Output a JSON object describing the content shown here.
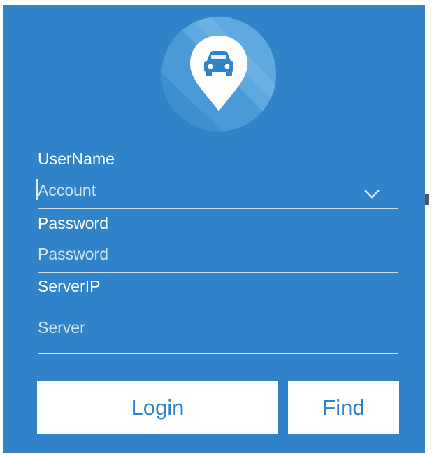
{
  "logo": {
    "icon": "car-location-pin-icon",
    "accent": "#3183c9"
  },
  "username": {
    "label": "UserName",
    "placeholder": "Account",
    "value": ""
  },
  "password": {
    "label": "Password",
    "placeholder": "Password",
    "value": ""
  },
  "server": {
    "label": "ServerIP",
    "placeholder": "Server",
    "value": ""
  },
  "buttons": {
    "login": "Login",
    "find": "Find"
  },
  "colors": {
    "background": "#3183c9",
    "button_bg": "#ffffff",
    "button_text": "#3183c9",
    "text": "#ffffff"
  }
}
